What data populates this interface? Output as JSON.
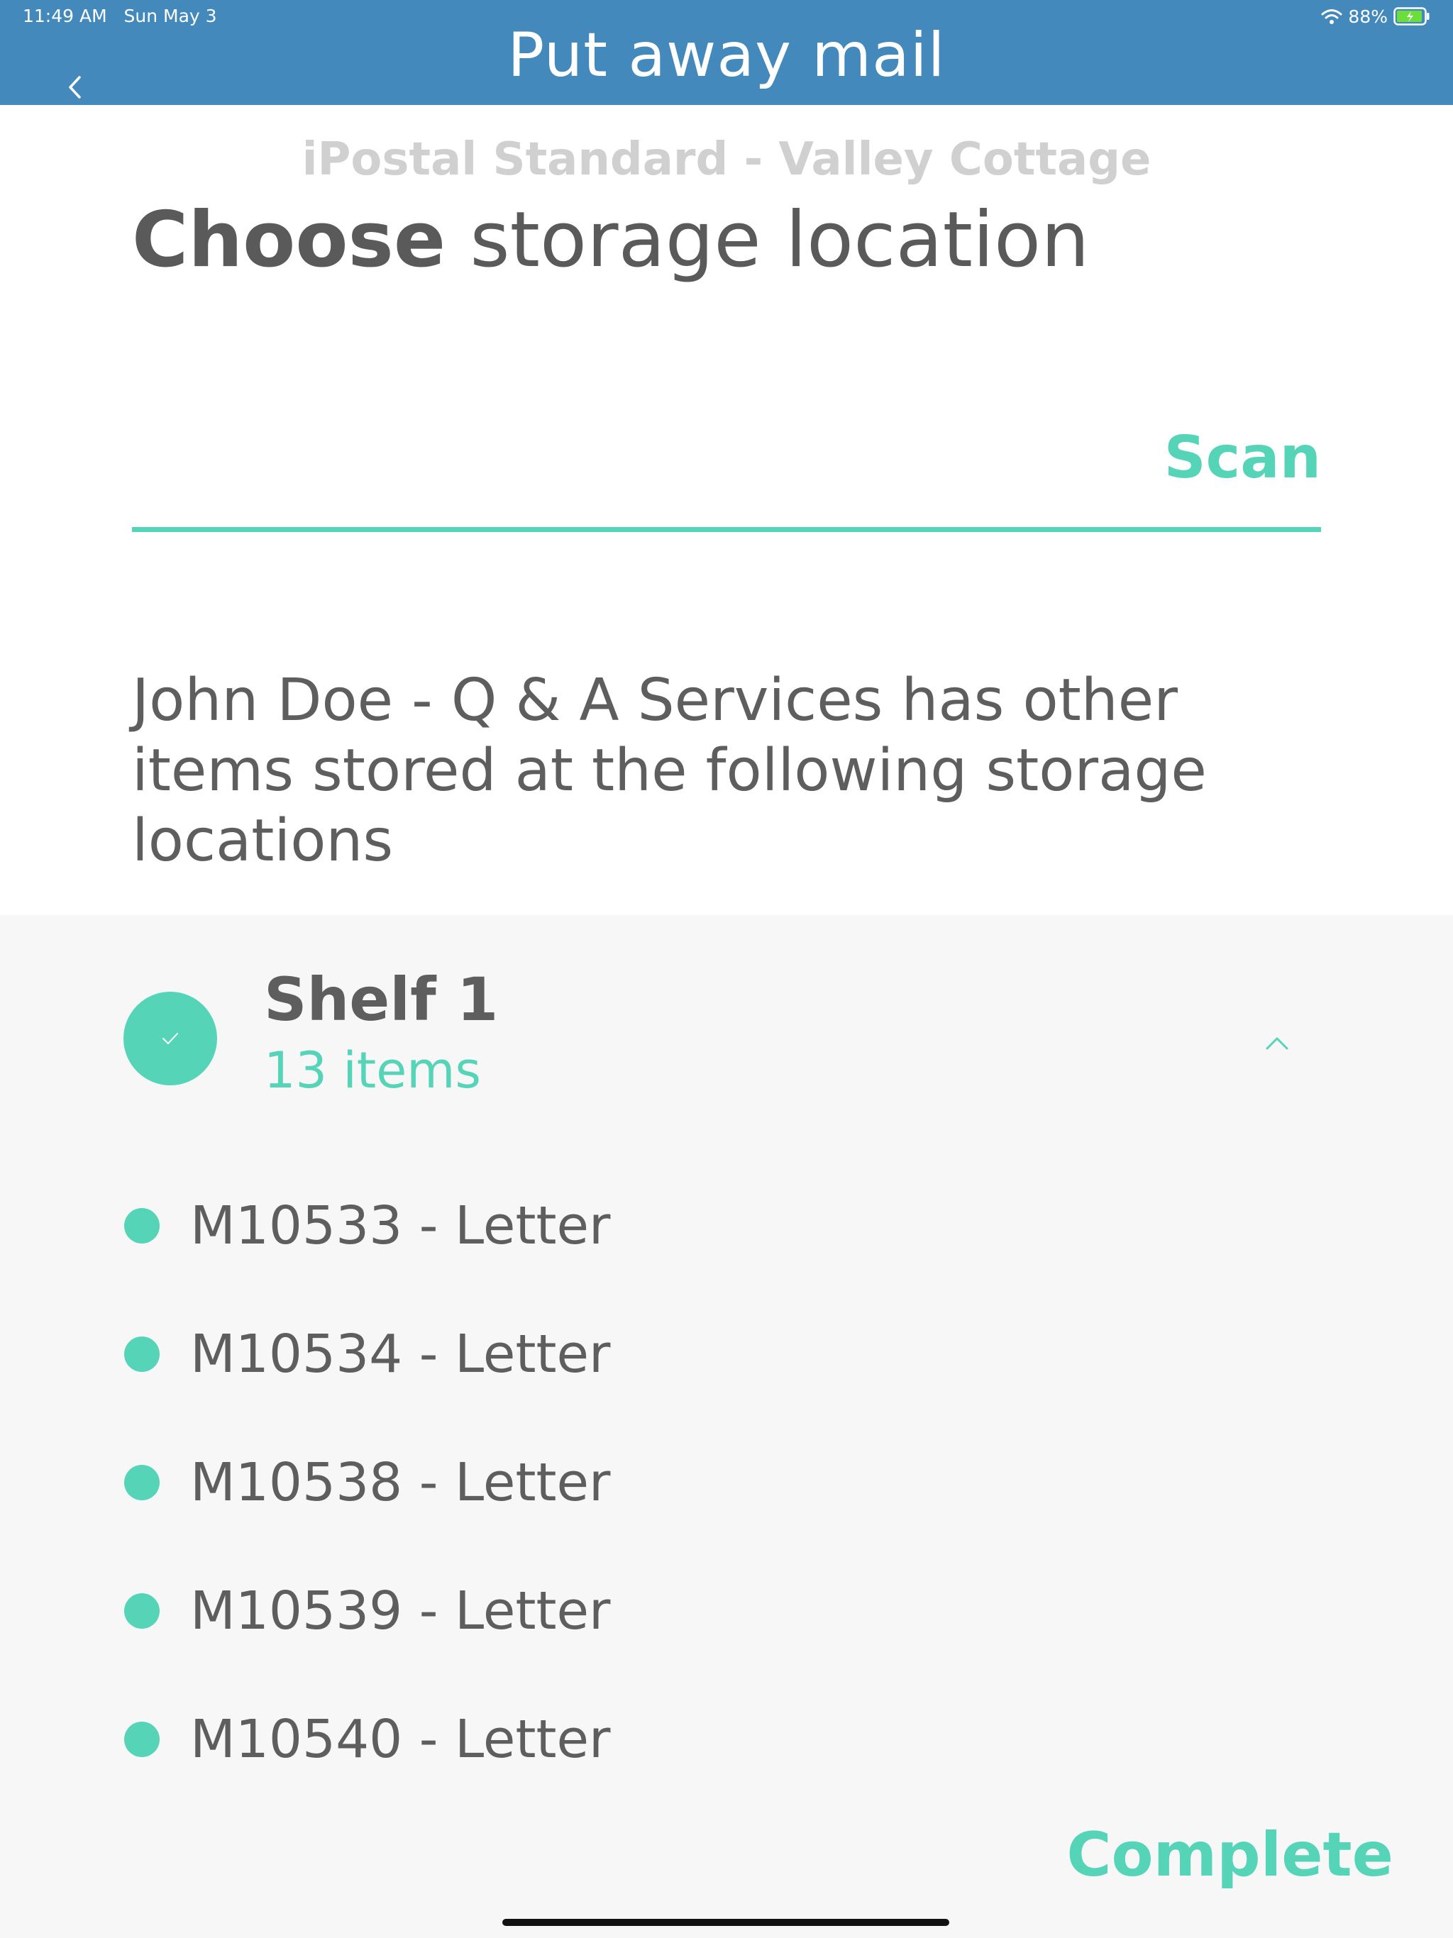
{
  "status_bar": {
    "time": "11:49 AM",
    "date": "Sun May 3",
    "battery": "88%",
    "icons": [
      "wifi-icon",
      "battery-charging-icon"
    ]
  },
  "header": {
    "title": "Put away mail",
    "back_icon": "chevron-left-icon"
  },
  "main": {
    "subtitle": "iPostal Standard - Valley Cottage",
    "heading_strong": "Choose",
    "heading_rest": " storage location",
    "scan_label": "Scan",
    "info_text": "John Doe - Q & A Services has other items stored at the following storage locations"
  },
  "shelf": {
    "name": "Shelf 1",
    "count": "13 items",
    "icons": [
      "check-icon",
      "chevron-up-icon"
    ],
    "items": [
      {
        "label": "M10533 - Letter"
      },
      {
        "label": "M10534 - Letter"
      },
      {
        "label": "M10538 - Letter"
      },
      {
        "label": "M10539 - Letter"
      },
      {
        "label": "M10540 - Letter"
      }
    ]
  },
  "footer": {
    "complete_label": "Complete"
  },
  "colors": {
    "header_bg": "#4389bc",
    "accent": "#56d4b8",
    "panel_bg": "#f7f7f7",
    "text": "#5e5e5e",
    "subtitle": "#d0d0d0"
  }
}
